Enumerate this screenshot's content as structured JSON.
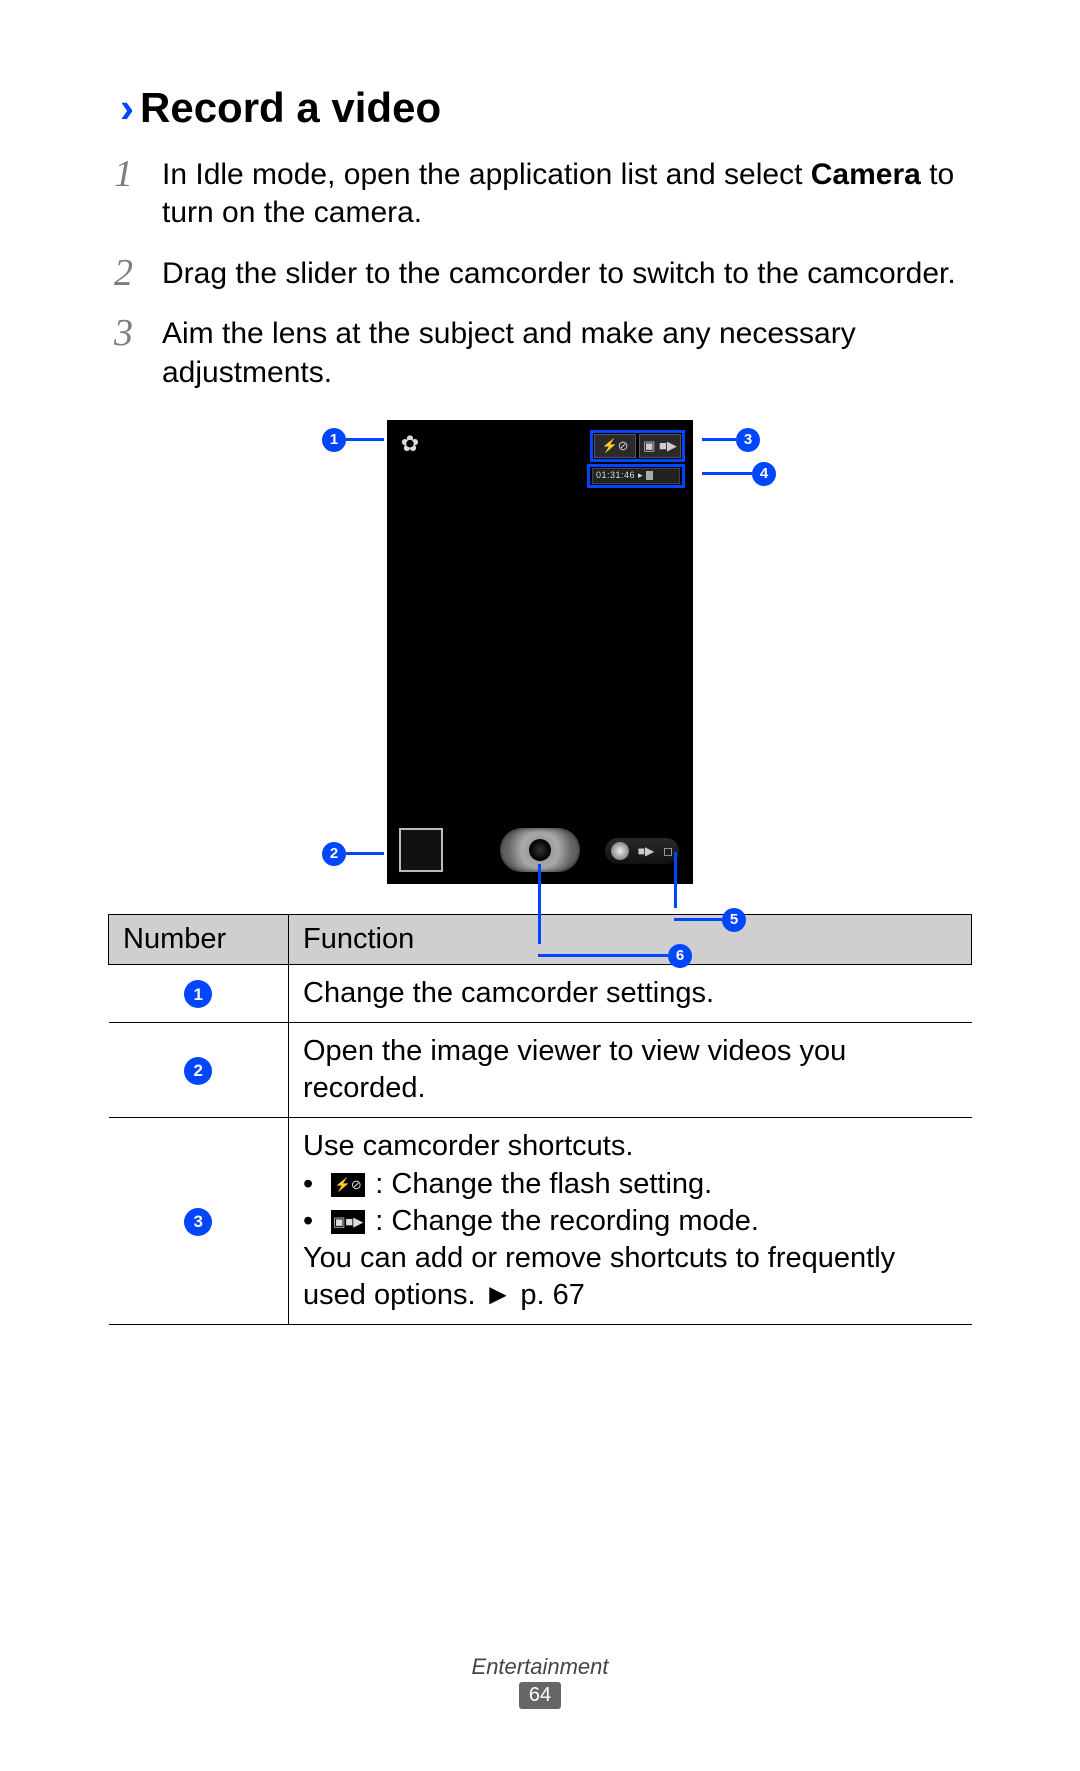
{
  "section": {
    "marker": "›",
    "title": "Record a video"
  },
  "steps": [
    {
      "pre": "In Idle mode, open the application list and select ",
      "bold": "Camera",
      "post": " to turn on the camera."
    },
    {
      "pre": "Drag the slider to the camcorder to switch to the camcorder.",
      "bold": "",
      "post": ""
    },
    {
      "pre": "Aim the lens at the subject and make any necessary adjustments.",
      "bold": "",
      "post": ""
    }
  ],
  "figure": {
    "callouts": [
      "1",
      "2",
      "3",
      "4",
      "5",
      "6"
    ],
    "shortcut_flash": "⚡⊘",
    "shortcut_mode": "▣ ■▶",
    "time_counter": "01:31:46 ▸",
    "gear_glyph": "✿",
    "slider_left": "■▶",
    "slider_right": "◻"
  },
  "table": {
    "headers": {
      "number": "Number",
      "function": "Function"
    },
    "rows": [
      {
        "num": "1",
        "func_plain": "Change the camcorder settings."
      },
      {
        "num": "2",
        "func_plain": "Open the image viewer to view videos you recorded."
      },
      {
        "num": "3",
        "func_intro": "Use camcorder shortcuts.",
        "bullets": [
          {
            "icon_label": "flash-off-icon",
            "icon_text": "⚡⊘",
            "text": " : Change the flash setting."
          },
          {
            "icon_label": "record-mode-icon",
            "icon_text": "▣■▶",
            "text": " : Change the recording mode."
          }
        ],
        "func_outro_pre": "You can add or remove shortcuts to frequently used options. ",
        "func_outro_arrow": "►",
        "func_outro_post": " p. 67"
      }
    ]
  },
  "footer": {
    "category": "Entertainment",
    "page": "64"
  }
}
